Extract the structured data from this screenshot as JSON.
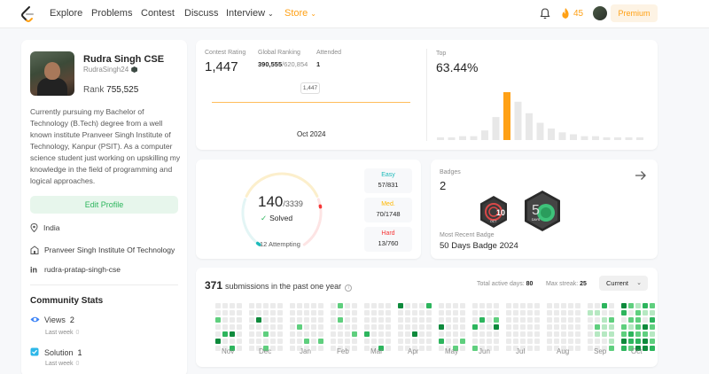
{
  "nav": {
    "items": [
      "Explore",
      "Problems",
      "Contest",
      "Discuss",
      "Interview",
      "Store"
    ],
    "streak": "45",
    "premium": "Premium"
  },
  "profile": {
    "name": "Rudra Singh CSE",
    "username": "RudraSingh24",
    "rank_label": "Rank",
    "rank_value": "755,525",
    "bio": "Currently pursuing my Bachelor of Technology (B.Tech) degree from a well known institute Pranveer Singh Institute of Technology, Kanpur (PSIT). As a computer science student just working on upskilling my knowledge in the field of programming and logical approaches.",
    "edit_label": "Edit Profile",
    "location": "India",
    "institute": "Pranveer Singh Institute Of Technology",
    "linkedin": "rudra-pratap-singh-cse"
  },
  "community": {
    "title": "Community Stats",
    "views_label": "Views",
    "views_value": "2",
    "views_sub": "Last week",
    "views_sub_val": "0",
    "solution_label": "Solution",
    "solution_value": "1",
    "solution_sub": "Last week",
    "solution_sub_val": "0"
  },
  "rating": {
    "contest_label": "Contest Rating",
    "contest_value": "1,447",
    "global_label": "Global Ranking",
    "global_value": "390,555",
    "global_total": "/620,854",
    "attended_label": "Attended",
    "attended_value": "1",
    "tooltip": "1,447",
    "date": "Oct 2024",
    "top_label": "Top",
    "top_value": "63.44%",
    "histogram": [
      1,
      1,
      2,
      2,
      5,
      12,
      25,
      20,
      14,
      9,
      6,
      4,
      3,
      2,
      2,
      1,
      1,
      1,
      1
    ],
    "highlight_index": 6,
    "highlight_color": "#ffa116",
    "bar_color": "#e8e8e8"
  },
  "solved": {
    "solved": "140",
    "total": "/3339",
    "solved_label": "Solved",
    "attempting": "12 Attempting",
    "easy_label": "Easy",
    "easy_value": "57/831",
    "med_label": "Med.",
    "med_value": "70/1748",
    "hard_label": "Hard",
    "hard_value": "13/760",
    "easy_fraction": 0.069,
    "med_fraction": 0.04,
    "hard_fraction": 0.017,
    "easy_color": "#1cbaba",
    "med_color": "#ffb700",
    "hard_color": "#f63737"
  },
  "badges": {
    "label": "Badges",
    "count": "2",
    "badge1_text": "OCT",
    "badge2_text": "DAYS",
    "recent_label": "Most Recent Badge",
    "recent_value": "50 Days Badge 2024"
  },
  "submissions": {
    "count": "371",
    "text": "submissions in the past one year",
    "active_label": "Total active days:",
    "active_value": "80",
    "streak_label": "Max streak:",
    "streak_value": "25",
    "select_value": "Current",
    "months": [
      "Nov",
      "Dec",
      "Jan",
      "Feb",
      "Mar",
      "Apr",
      "May",
      "Jun",
      "Jul",
      "Aug",
      "Sep",
      "Oct"
    ]
  }
}
